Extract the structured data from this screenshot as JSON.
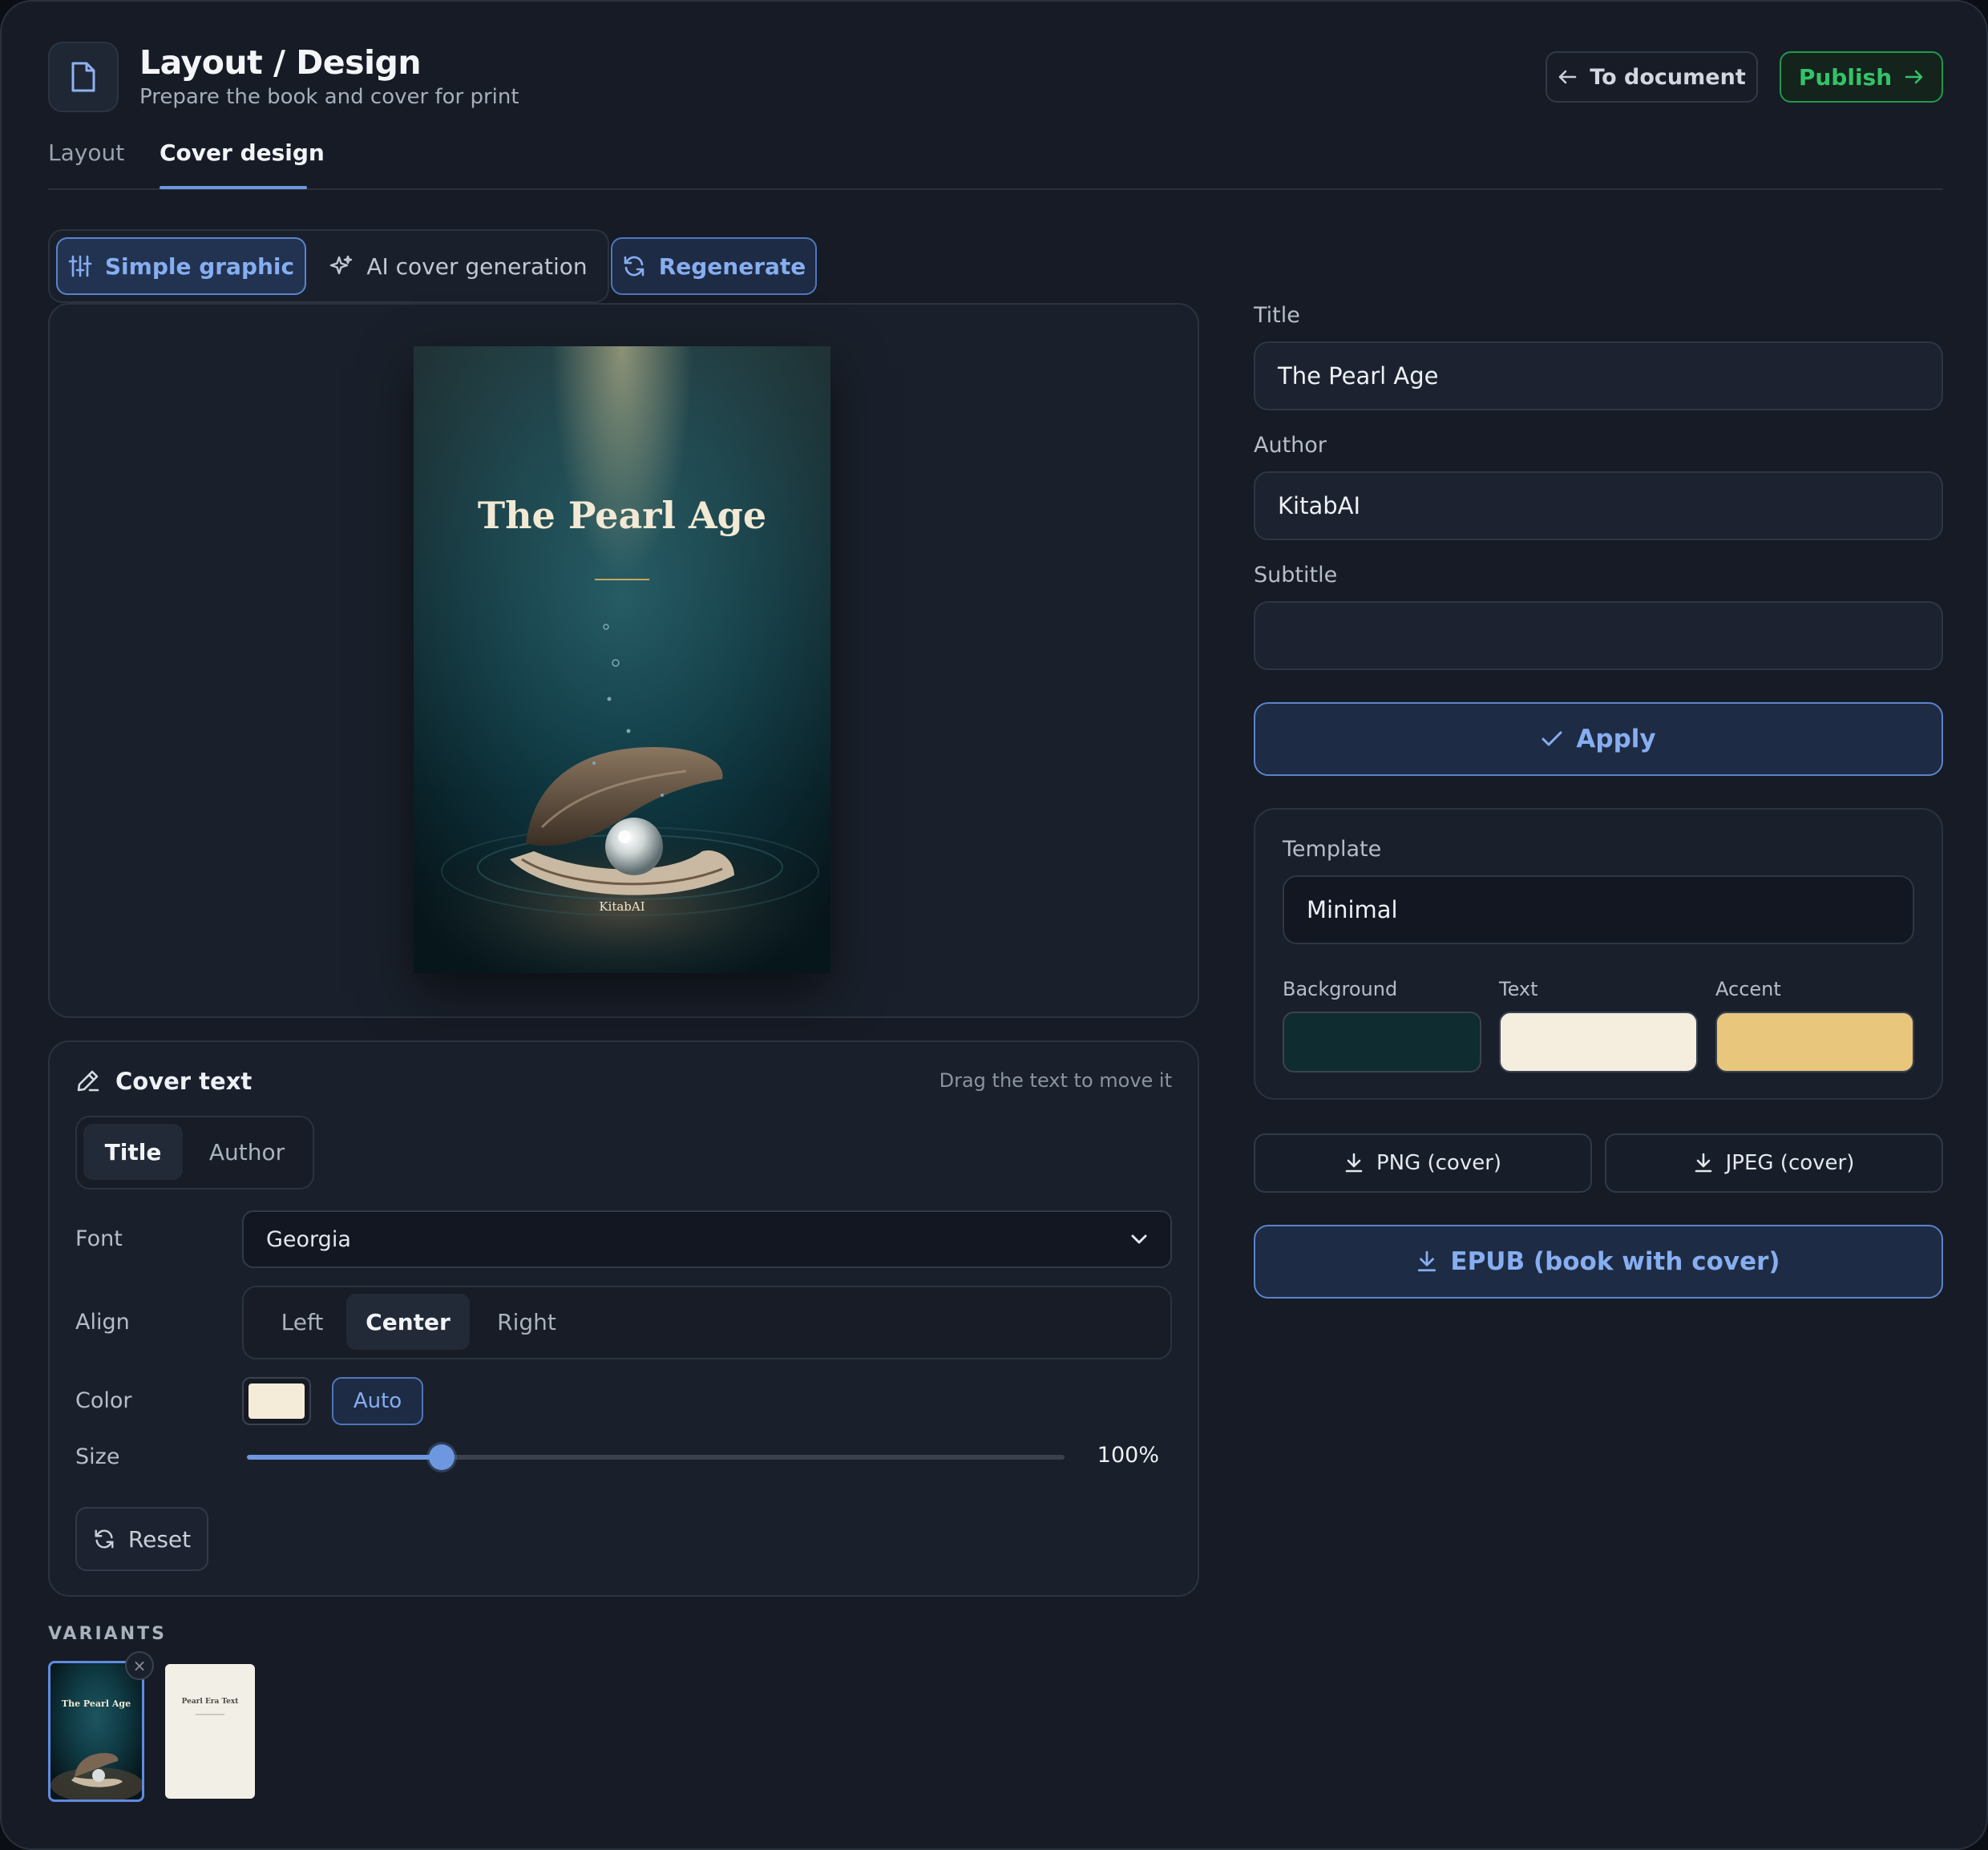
{
  "header": {
    "title": "Layout / Design",
    "subtitle": "Prepare the book and cover for print",
    "to_document_label": "To document",
    "publish_label": "Publish"
  },
  "tabs": [
    {
      "label": "Layout",
      "active": false
    },
    {
      "label": "Cover design",
      "active": true
    }
  ],
  "mode": {
    "simple_label": "Simple graphic",
    "ai_label": "AI cover generation",
    "regenerate_label": "Regenerate",
    "selected": "Simple graphic"
  },
  "cover": {
    "title": "The Pearl Age",
    "author": "KitabAI"
  },
  "cover_text": {
    "heading": "Cover text",
    "hint": "Drag the text to move it",
    "target_tabs": [
      "Title",
      "Author"
    ],
    "selected_target": "Title",
    "font_label": "Font",
    "font_value": "Georgia",
    "align_label": "Align",
    "align_options": [
      "Left",
      "Center",
      "Right"
    ],
    "align_selected": "Center",
    "color_label": "Color",
    "color_value": "#f4ecd9",
    "auto_label": "Auto",
    "size_label": "Size",
    "size_percent": 100,
    "size_slider_fraction": 0.238,
    "size_value_text": "100%",
    "reset_label": "Reset"
  },
  "variants": {
    "label": "VARIANTS",
    "items": [
      {
        "title": "The Pearl Age",
        "selected": true
      },
      {
        "title": "Pearl Era Text",
        "selected": false
      }
    ],
    "close_glyph": "×"
  },
  "form": {
    "title_label": "Title",
    "title_value": "The Pearl Age",
    "author_label": "Author",
    "author_value": "KitabAI",
    "subtitle_label": "Subtitle",
    "subtitle_value": "",
    "apply_label": "Apply"
  },
  "template": {
    "label": "Template",
    "value": "Minimal",
    "background_label": "Background",
    "text_label": "Text",
    "accent_label": "Accent",
    "background_color": "#0f2c30",
    "text_color": "#f5eedf",
    "accent_color": "#e8c77c"
  },
  "downloads": {
    "png_label": "PNG (cover)",
    "jpeg_label": "JPEG (cover)",
    "epub_label": "EPUB (book with cover)"
  },
  "colors": {
    "accent": "#6d98e0",
    "publish": "#33c36a"
  }
}
